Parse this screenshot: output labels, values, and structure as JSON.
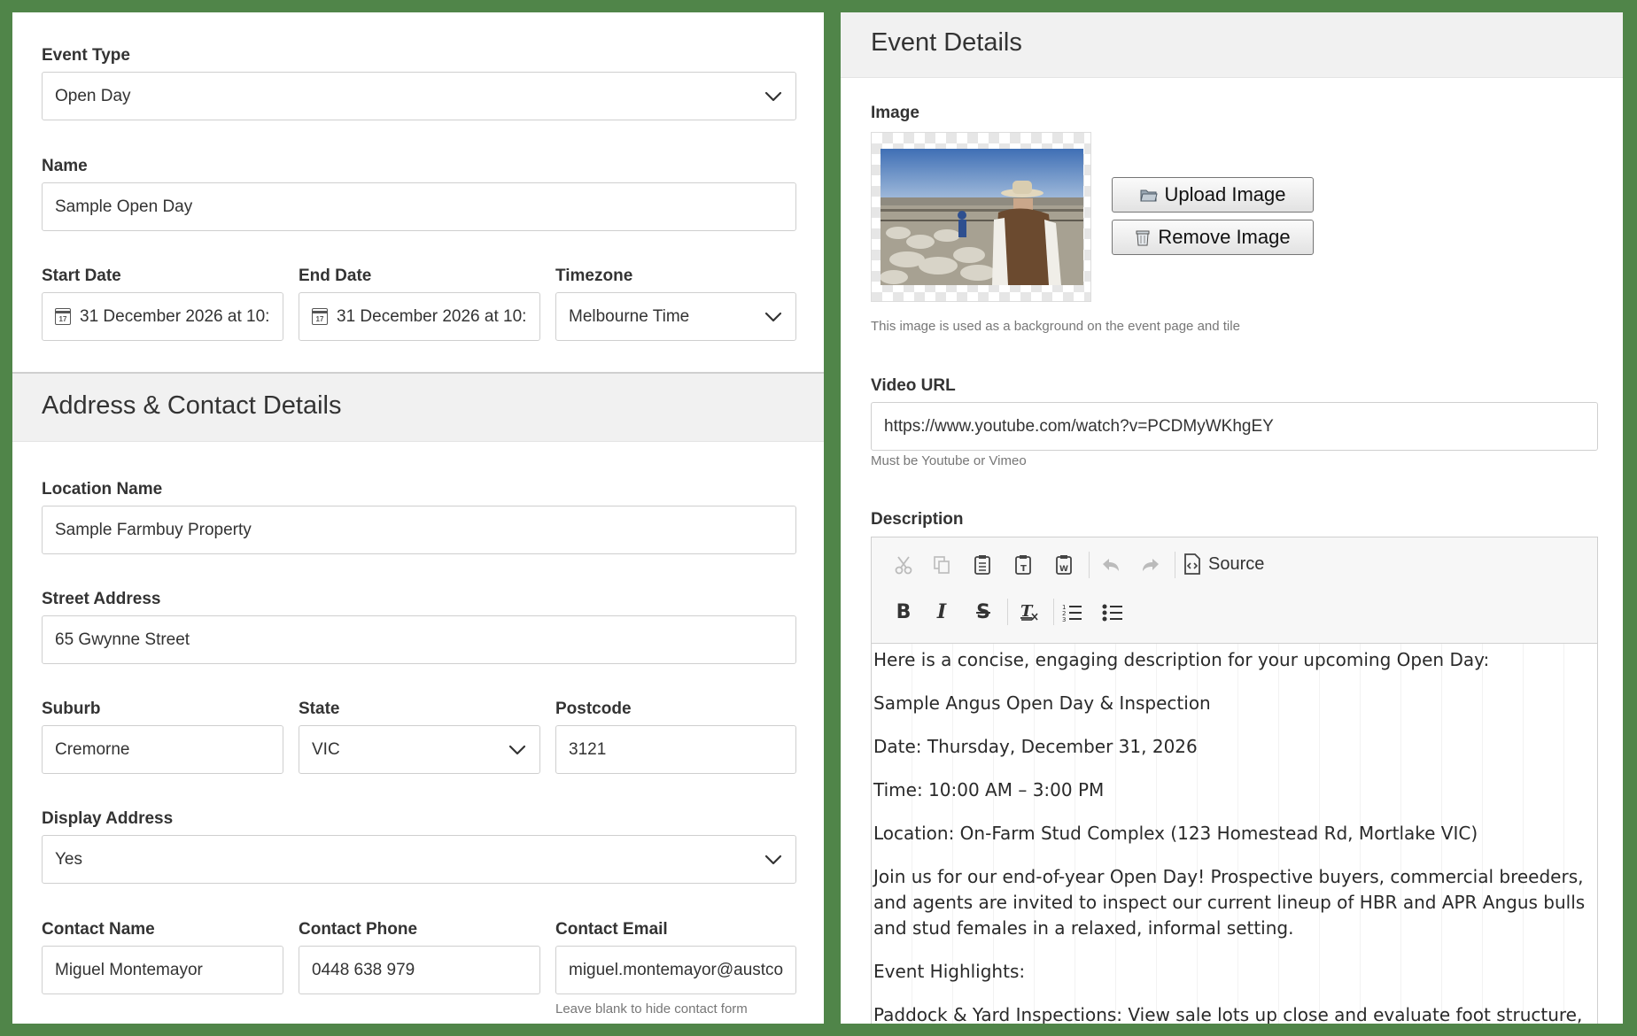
{
  "left": {
    "event_type": {
      "label": "Event Type",
      "value": "Open Day"
    },
    "name": {
      "label": "Name",
      "value": "Sample Open Day"
    },
    "start_date": {
      "label": "Start Date",
      "value": "31 December 2026 at 10::"
    },
    "end_date": {
      "label": "End Date",
      "value": "31 December 2026 at 10::"
    },
    "timezone": {
      "label": "Timezone",
      "value": "Melbourne Time"
    },
    "address_section_title": "Address & Contact Details",
    "location_name": {
      "label": "Location Name",
      "value": "Sample Farmbuy Property"
    },
    "street_address": {
      "label": "Street Address",
      "value": "65 Gwynne Street"
    },
    "suburb": {
      "label": "Suburb",
      "value": "Cremorne"
    },
    "state": {
      "label": "State",
      "value": "VIC"
    },
    "postcode": {
      "label": "Postcode",
      "value": "3121"
    },
    "display_address": {
      "label": "Display Address",
      "value": "Yes"
    },
    "contact_name": {
      "label": "Contact Name",
      "value": "Miguel Montemayor"
    },
    "contact_phone": {
      "label": "Contact Phone",
      "value": "0448 638 979"
    },
    "contact_email": {
      "label": "Contact Email",
      "value": "miguel.montemayor@austco"
    },
    "contact_email_hint": "Leave blank to hide contact form",
    "calendar_icon_day": "17"
  },
  "right": {
    "section_title": "Event Details",
    "image_label": "Image",
    "upload_button": "Upload Image",
    "remove_button": "Remove Image",
    "image_hint": "This image is used as a background on the event page and tile",
    "video_label": "Video URL",
    "video_value": "https://www.youtube.com/watch?v=PCDMyWKhgEY",
    "video_hint": "Must be Youtube or Vimeo",
    "description_label": "Description",
    "toolbar": {
      "source_label": "Source",
      "row1_icons": [
        "cut-icon",
        "copy-icon",
        "paste-icon",
        "paste-text-icon",
        "paste-word-icon",
        "undo-icon",
        "redo-icon",
        "source-icon"
      ],
      "row2_icons": [
        "bold-icon",
        "italic-icon",
        "strikethrough-icon",
        "remove-format-icon",
        "numbered-list-icon",
        "bulleted-list-icon"
      ]
    },
    "description_paragraphs": [
      "Here is a concise, engaging description for your upcoming Open Day:",
      "Sample Angus Open Day & Inspection",
      "Date: Thursday, December 31, 2026",
      "Time: 10:00 AM – 3:00 PM",
      "Location: On-Farm Stud Complex (123 Homestead Rd, Mortlake VIC)",
      "Join us for our end-of-year Open Day! Prospective buyers, commercial breeders, and agents are invited to inspect our current lineup of HBR and APR Angus bulls and stud females in a relaxed, informal setting.",
      "Event Highlights:",
      "Paddock & Yard Inspections: View sale lots up close and evaluate foot structure,"
    ]
  },
  "colors": {
    "frame_green": "#508549",
    "section_bg": "#f1f1f1",
    "border": "#cfcfcf"
  }
}
